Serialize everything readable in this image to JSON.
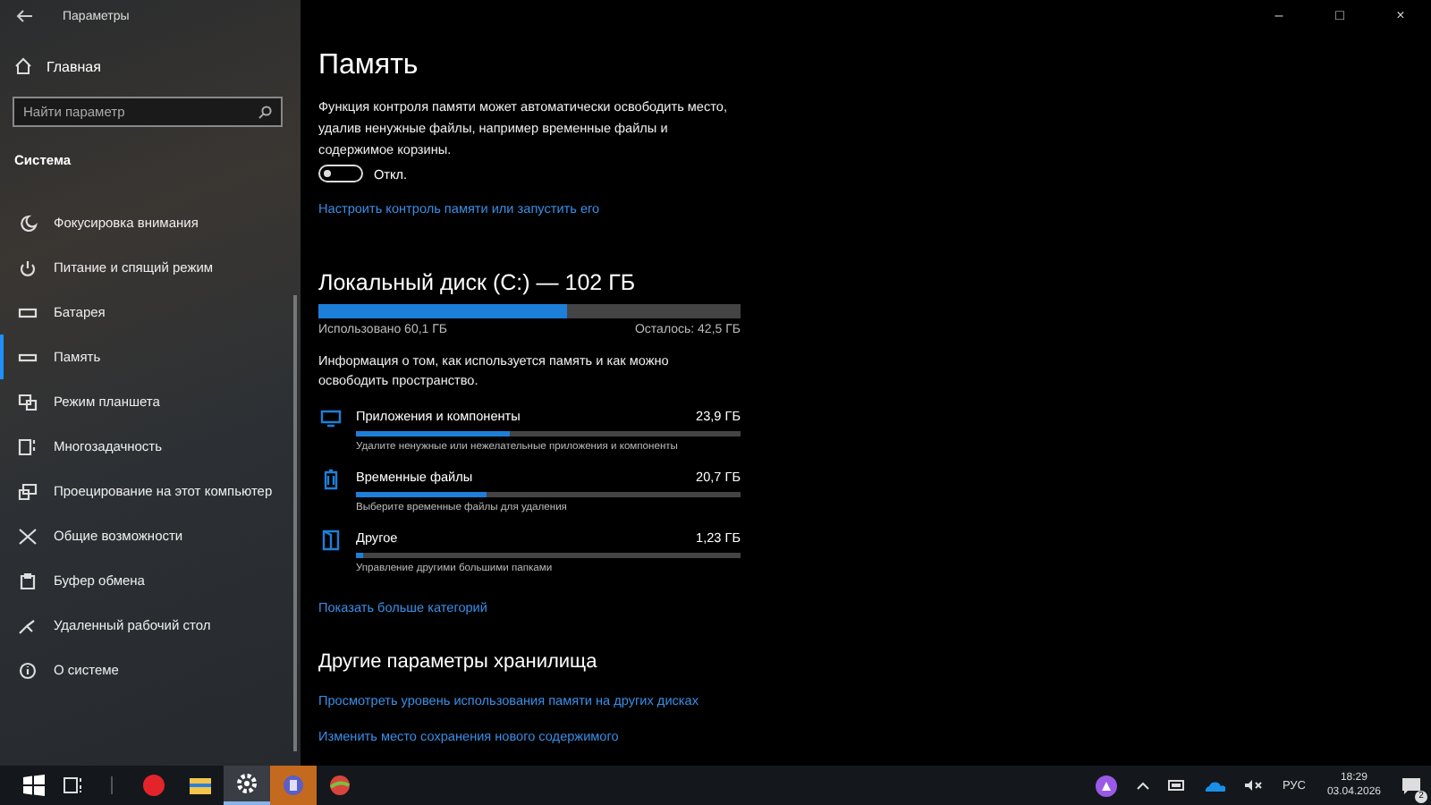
{
  "window": {
    "title": "Параметры",
    "controls": [
      "–",
      "□",
      "×"
    ]
  },
  "sidebar": {
    "home": "Главная",
    "search": {
      "placeholder": "Найти параметр"
    },
    "section": "Система",
    "items": [
      {
        "label": "Фокусировка внимания",
        "selected": false
      },
      {
        "label": "Питание и спящий режим",
        "selected": false
      },
      {
        "label": "Батарея",
        "selected": false
      },
      {
        "label": "Память",
        "selected": true
      },
      {
        "label": "Режим планшета",
        "selected": false
      },
      {
        "label": "Многозадачность",
        "selected": false
      },
      {
        "label": "Проецирование на этот компьютер",
        "selected": false
      },
      {
        "label": "Общие возможности",
        "selected": false
      },
      {
        "label": "Буфер обмена",
        "selected": false
      },
      {
        "label": "Удаленный рабочий стол",
        "selected": false
      },
      {
        "label": "О системе",
        "selected": false
      }
    ]
  },
  "page": {
    "title": "Память",
    "description": "Функция контроля памяти может автоматически освободить место, удалив ненужные файлы, например временные файлы и содержимое корзины.",
    "toggle": {
      "on": false,
      "label": "Откл."
    },
    "configure_link": "Настроить контроль памяти или запустить его",
    "disk": {
      "title": "Локальный диск (C:) — 102 ГБ",
      "level": 0.59,
      "used": "Использовано 60,1 ГБ",
      "free": "Осталось: 42,5 ГБ"
    },
    "info": "Информация о том, как используется память и как можно освободить пространство.",
    "categories": [
      {
        "name": "Приложения и компоненты",
        "size": "23,9 ГБ",
        "level": 0.4,
        "hint": "Удалите ненужные или нежелательные приложения и компоненты"
      },
      {
        "name": "Временные файлы",
        "size": "20,7 ГБ",
        "level": 0.34,
        "hint": "Выберите временные файлы для удаления"
      },
      {
        "name": "Другое",
        "size": "1,23 ГБ",
        "level": 0.02,
        "hint": "Управление другими большими папками"
      }
    ],
    "more_link": "Показать больше категорий",
    "other_title": "Другие параметры хранилища",
    "other_links": [
      "Просмотреть уровень использования памяти на других дисках",
      "Изменить место сохранения нового содержимого"
    ]
  },
  "taskbar": {
    "apps": [
      {
        "active": false,
        "attention": false
      },
      {
        "active": false,
        "attention": false
      },
      {
        "active": true,
        "attention": false
      },
      {
        "active": false,
        "attention": true
      },
      {
        "active": false,
        "attention": false
      }
    ],
    "language": "РУС",
    "time": "18:29",
    "date": "03.04.2026",
    "notifications": "2"
  }
}
